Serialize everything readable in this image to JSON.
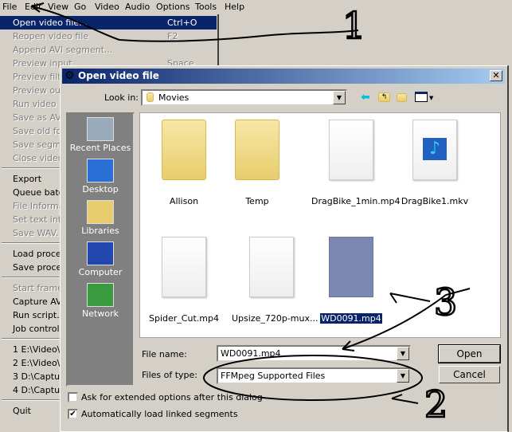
{
  "menubar": [
    "File",
    "Edit",
    "View",
    "Go",
    "Video",
    "Audio",
    "Options",
    "Tools",
    "Help"
  ],
  "menu": [
    {
      "label": "Open video file...",
      "shortcut": "Ctrl+O",
      "state": "selected"
    },
    {
      "label": "Reopen video file",
      "shortcut": "F2",
      "state": "disabled"
    },
    {
      "label": "Append AVI segment...",
      "state": "disabled"
    },
    {
      "label": "Preview input",
      "shortcut": "Space",
      "state": "disabled"
    },
    {
      "label": "Preview filte",
      "state": "disabled"
    },
    {
      "label": "Preview out",
      "state": "disabled"
    },
    {
      "label": "Run video a",
      "state": "disabled"
    },
    {
      "label": "Save as AVI",
      "state": "disabled"
    },
    {
      "label": "Save old for",
      "state": "disabled"
    },
    {
      "label": "Save segme",
      "state": "disabled"
    },
    {
      "label": "Close video",
      "state": "disabled"
    },
    {
      "sep": true
    },
    {
      "label": "Export",
      "state": "normal"
    },
    {
      "label": "Queue batc",
      "state": "normal"
    },
    {
      "label": "File Informa",
      "state": "disabled"
    },
    {
      "label": "Set text inf",
      "state": "disabled"
    },
    {
      "label": "Save WAV.",
      "state": "disabled"
    },
    {
      "sep": true
    },
    {
      "label": "Load proces",
      "state": "normal"
    },
    {
      "label": "Save proces",
      "state": "normal"
    },
    {
      "sep": true
    },
    {
      "label": "Start frame",
      "state": "disabled"
    },
    {
      "label": "Capture AV",
      "state": "normal"
    },
    {
      "label": "Run script..",
      "state": "normal"
    },
    {
      "label": "Job control.",
      "state": "normal"
    },
    {
      "sep": true
    },
    {
      "label": "1 E:\\Video\\I",
      "state": "normal"
    },
    {
      "label": "2 E:\\Video\\L",
      "state": "normal"
    },
    {
      "label": "3 D:\\Captur",
      "state": "normal"
    },
    {
      "label": "4 D:\\Captur",
      "state": "normal"
    },
    {
      "sep": true
    },
    {
      "label": "Quit",
      "state": "normal"
    }
  ],
  "dialog": {
    "title": "Open video file",
    "look_in_label": "Look in:",
    "look_in_value": "Movies",
    "toolbar_icons": [
      "back-icon",
      "up-folder-icon",
      "new-folder-icon",
      "view-menu-icon"
    ],
    "places": [
      "Recent Places",
      "Desktop",
      "Libraries",
      "Computer",
      "Network"
    ],
    "files": [
      {
        "name": "Allison",
        "type": "folder"
      },
      {
        "name": "Temp",
        "type": "folder"
      },
      {
        "name": "DragBike_1min.mp4",
        "type": "document"
      },
      {
        "name": "DragBike1.mkv",
        "type": "media"
      },
      {
        "name": "Spider_Cut.mp4",
        "type": "document"
      },
      {
        "name": "Upsize_720p-mux...",
        "type": "document"
      },
      {
        "name": "WD0091.mp4",
        "type": "document",
        "selected": true
      }
    ],
    "file_name_label": "File name:",
    "file_name_value": "WD0091.mp4",
    "file_type_label": "Files of type:",
    "file_type_value": "FFMpeg Supported Files",
    "open_label": "Open",
    "cancel_label": "Cancel",
    "ask_extended_label": "Ask for extended options after this dialog",
    "ask_extended_checked": false,
    "auto_load_label": "Automatically load linked segments",
    "auto_load_checked": true
  },
  "annotations": [
    "1",
    "2",
    "3"
  ]
}
